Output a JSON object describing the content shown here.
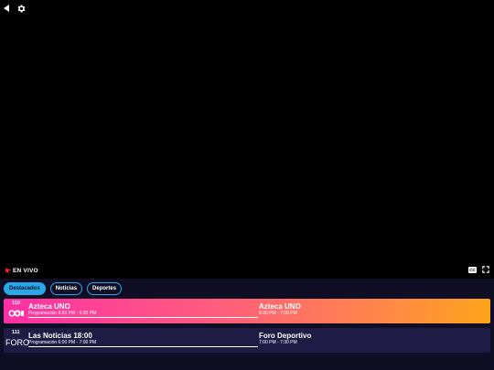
{
  "colors": {
    "accent": "#2aa7e8",
    "guide_bg": "#0f0e24",
    "row_bg": "#1e1b45",
    "live_red": "#e8252a",
    "row_gradient_start": "#ff2fa5",
    "row_gradient_end": "#ffa31a"
  },
  "top_bar": {
    "icons": [
      "back-icon",
      "gear-icon"
    ]
  },
  "player": {
    "live_label": "EN VIVO",
    "cc_label": "CC",
    "icons": [
      "live-icon",
      "cc-icon",
      "fullscreen-icon"
    ]
  },
  "tabs": [
    {
      "label": "Destacados",
      "active": true
    },
    {
      "label": "Noticias",
      "active": false
    },
    {
      "label": "Deportes",
      "active": false
    }
  ],
  "guide": {
    "rows": [
      {
        "channel_number": "110",
        "logo_text": "",
        "current_title": "Azteca UNO",
        "current_time": "Programación 6:00 PM - 6:30 PM",
        "progress": 1.0,
        "next_title": "Azteca UNO",
        "next_time": "6:30 PM - 7:00 PM"
      },
      {
        "channel_number": "111",
        "logo_text": "FORO",
        "current_title": "Las Noticias 18:00",
        "current_time": "Programación 6:00 PM - 7:00 PM",
        "progress": 1.0,
        "next_title": "Foro Deportivo",
        "next_time": "7:00 PM - 7:30 PM"
      }
    ]
  }
}
